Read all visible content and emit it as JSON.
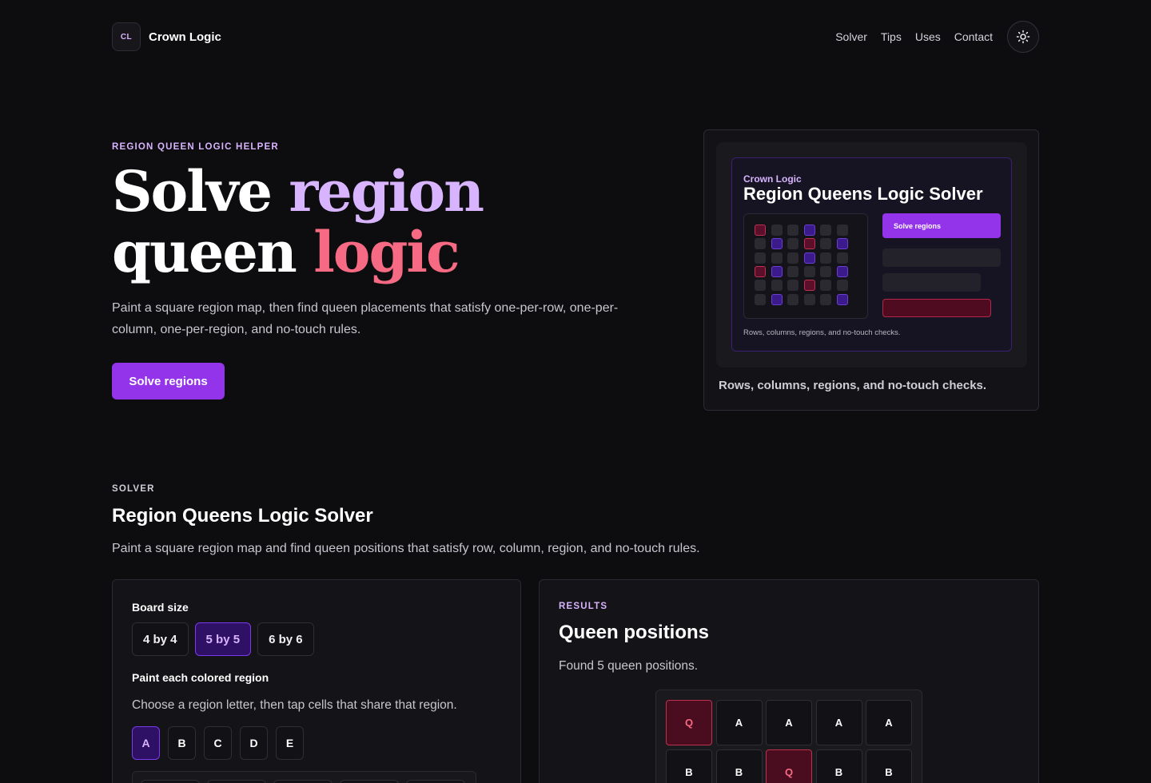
{
  "header": {
    "logo_text": "CL",
    "brand_name": "Crown Logic",
    "nav": [
      "Solver",
      "Tips",
      "Uses",
      "Contact"
    ]
  },
  "hero": {
    "eyebrow": "REGION QUEEN LOGIC HELPER",
    "title_word1": "Solve",
    "title_word2": "region",
    "title_word3": "queen",
    "title_word4": "logic",
    "description": "Paint a square region map, then find queen placements that satisfy one-per-row, one-per-column, one-per-region, and no-touch rules.",
    "cta": "Solve regions"
  },
  "preview": {
    "brand": "Crown Logic",
    "title": "Region Queens Logic Solver",
    "button": "Solve regions",
    "inner_caption": "Rows, columns, regions, and no-touch checks.",
    "caption": "Rows, columns, regions, and no-touch checks."
  },
  "solver": {
    "eyebrow": "SOLVER",
    "title": "Region Queens Logic Solver",
    "description": "Paint a square region map and find queen positions that satisfy row, column, region, and no-touch rules.",
    "board_size_label": "Board size",
    "sizes": [
      "4 by 4",
      "5 by 5",
      "6 by 6"
    ],
    "selected_size": "5 by 5",
    "paint_label": "Paint each colored region",
    "paint_hint": "Choose a region letter, then tap cells that share that region.",
    "regions": [
      "A",
      "B",
      "C",
      "D",
      "E"
    ],
    "selected_region": "A"
  },
  "results": {
    "eyebrow": "RESULTS",
    "title": "Queen positions",
    "summary": "Found 5 queen positions.",
    "rows": [
      [
        "Q",
        "A",
        "A",
        "A",
        "A"
      ],
      [
        "B",
        "B",
        "Q",
        "B",
        "B"
      ]
    ]
  },
  "colors": {
    "accent": "#9333ea",
    "accent_light": "#d8b4fe",
    "pink": "#f76a83",
    "background": "#0d0d0f"
  }
}
